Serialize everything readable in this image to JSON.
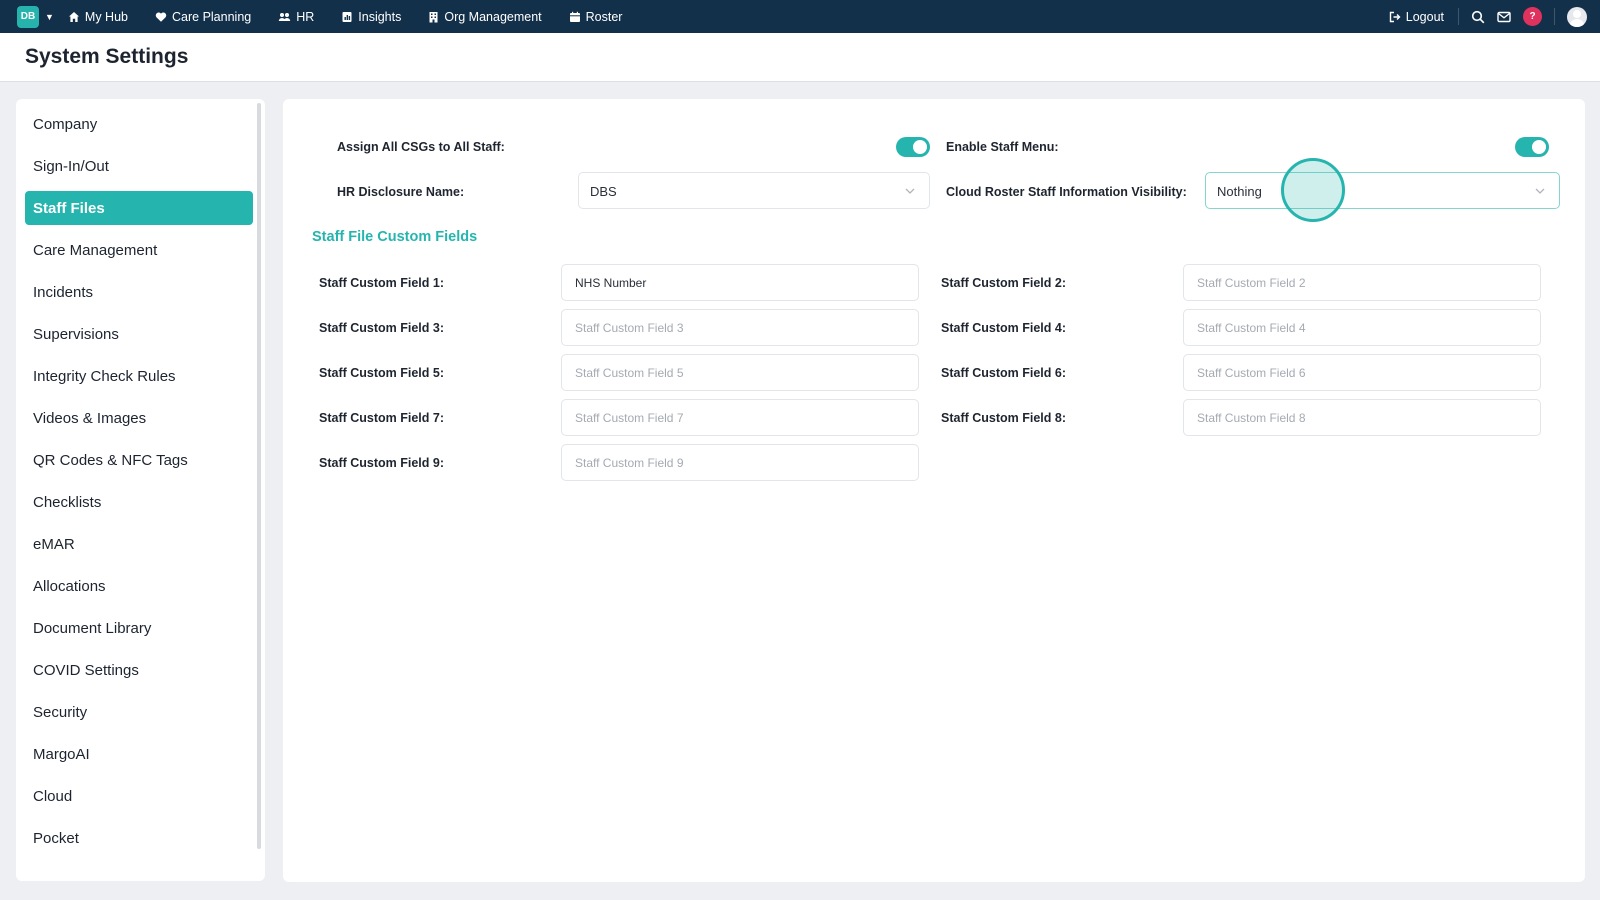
{
  "nav": {
    "account_initials": "DB",
    "items": [
      {
        "label": "My Hub",
        "icon": "home-icon"
      },
      {
        "label": "Care Planning",
        "icon": "heart-icon"
      },
      {
        "label": "HR",
        "icon": "people-icon"
      },
      {
        "label": "Insights",
        "icon": "chart-book-icon"
      },
      {
        "label": "Org Management",
        "icon": "building-icon"
      },
      {
        "label": "Roster",
        "icon": "calendar-icon"
      }
    ],
    "logout_label": "Logout",
    "help_label": "?"
  },
  "page": {
    "title": "System Settings"
  },
  "sidebar": {
    "items": [
      {
        "label": "Company",
        "active": false
      },
      {
        "label": "Sign-In/Out",
        "active": false
      },
      {
        "label": "Staff Files",
        "active": true
      },
      {
        "label": "Care Management",
        "active": false
      },
      {
        "label": "Incidents",
        "active": false
      },
      {
        "label": "Supervisions",
        "active": false
      },
      {
        "label": "Integrity Check Rules",
        "active": false
      },
      {
        "label": "Videos & Images",
        "active": false
      },
      {
        "label": "QR Codes & NFC Tags",
        "active": false
      },
      {
        "label": "Checklists",
        "active": false
      },
      {
        "label": "eMAR",
        "active": false
      },
      {
        "label": "Allocations",
        "active": false
      },
      {
        "label": "Document Library",
        "active": false
      },
      {
        "label": "COVID Settings",
        "active": false
      },
      {
        "label": "Security",
        "active": false
      },
      {
        "label": "MargoAI",
        "active": false
      },
      {
        "label": "Cloud",
        "active": false
      },
      {
        "label": "Pocket",
        "active": false
      }
    ]
  },
  "settings": {
    "assign_csgs_label": "Assign All CSGs to All Staff:",
    "assign_csgs_on": true,
    "enable_staff_menu_label": "Enable Staff Menu:",
    "enable_staff_menu_on": true,
    "hr_disclosure_label": "HR Disclosure Name:",
    "hr_disclosure_value": "DBS",
    "cloud_roster_label": "Cloud Roster Staff Information Visibility:",
    "cloud_roster_value": "Nothing"
  },
  "custom_fields": {
    "section_title": "Staff File Custom Fields",
    "fields": [
      {
        "label": "Staff Custom Field 1:",
        "value": "NHS Number",
        "placeholder": "Staff Custom Field 1"
      },
      {
        "label": "Staff Custom Field 2:",
        "value": "",
        "placeholder": "Staff Custom Field 2"
      },
      {
        "label": "Staff Custom Field 3:",
        "value": "",
        "placeholder": "Staff Custom Field 3"
      },
      {
        "label": "Staff Custom Field 4:",
        "value": "",
        "placeholder": "Staff Custom Field 4"
      },
      {
        "label": "Staff Custom Field 5:",
        "value": "",
        "placeholder": "Staff Custom Field 5"
      },
      {
        "label": "Staff Custom Field 6:",
        "value": "",
        "placeholder": "Staff Custom Field 6"
      },
      {
        "label": "Staff Custom Field 7:",
        "value": "",
        "placeholder": "Staff Custom Field 7"
      },
      {
        "label": "Staff Custom Field 8:",
        "value": "",
        "placeholder": "Staff Custom Field 8"
      },
      {
        "label": "Staff Custom Field 9:",
        "value": "",
        "placeholder": "Staff Custom Field 9"
      }
    ]
  },
  "colors": {
    "accent": "#26b5ae",
    "topbar": "#13304a",
    "help_badge": "#e0325e"
  }
}
